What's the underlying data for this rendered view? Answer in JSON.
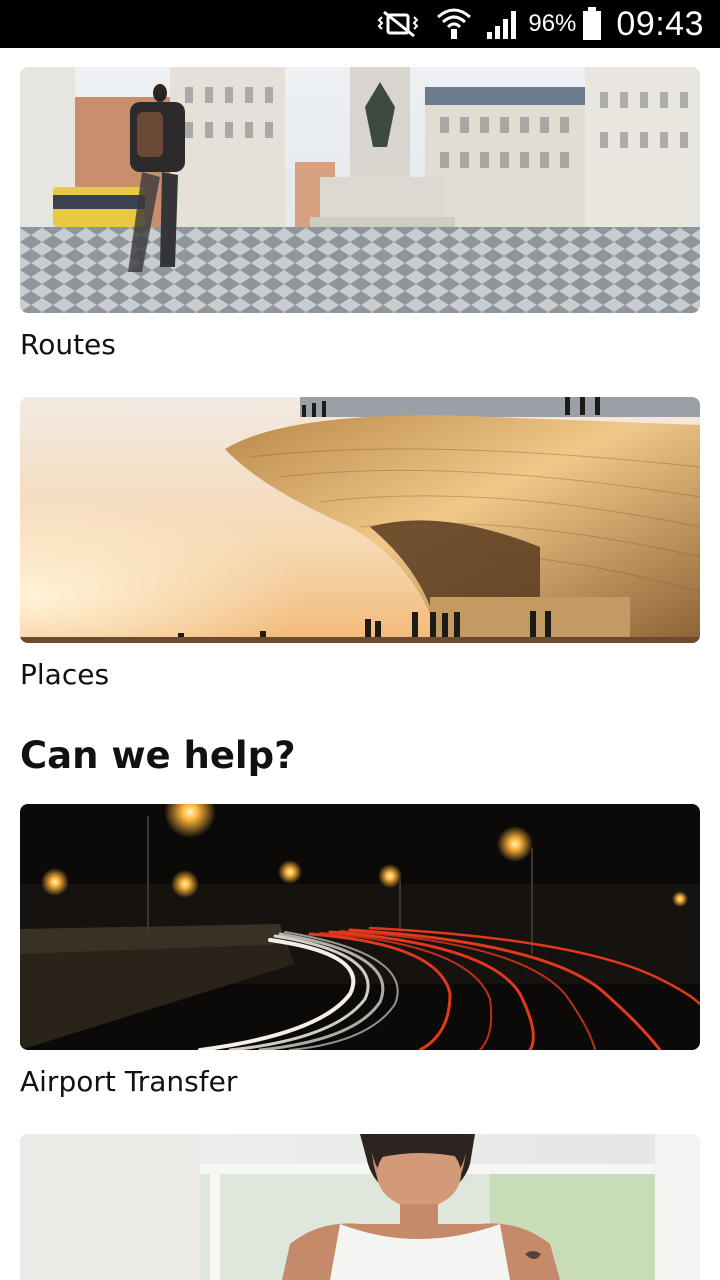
{
  "status_bar": {
    "battery_percent": "96%",
    "time": "09:43",
    "icons": [
      "vibrate-mute-icon",
      "wifi-icon",
      "signal-icon",
      "battery-icon"
    ]
  },
  "cards": [
    {
      "label": "Routes",
      "image": "city-square-photo"
    },
    {
      "label": "Places",
      "image": "museum-sunset-photo"
    }
  ],
  "help_section": {
    "title": "Can we help?",
    "cards": [
      {
        "label": "Airport Transfer",
        "image": "night-highway-photo"
      },
      {
        "label": "",
        "image": "man-portrait-photo"
      }
    ]
  },
  "colors": {
    "status_bar_bg": "#000000",
    "text": "#111111",
    "background": "#ffffff"
  }
}
